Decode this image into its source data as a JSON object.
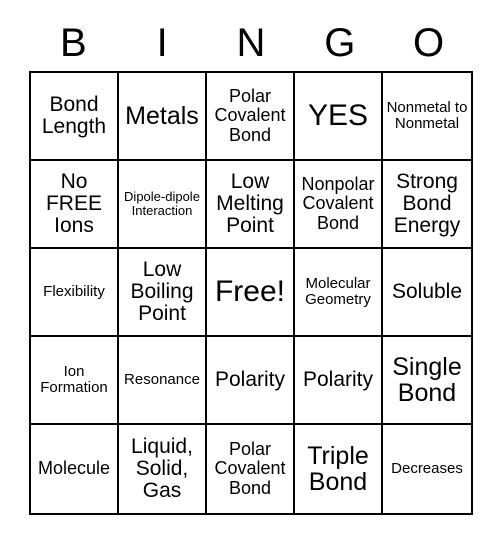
{
  "card": {
    "type": "bingo-card",
    "columns": 5,
    "rows": 5,
    "header": {
      "letters": [
        "B",
        "I",
        "N",
        "G",
        "O"
      ]
    },
    "colors": {
      "border": "#000000",
      "background": "#ffffff",
      "text": "#000000"
    },
    "cells": [
      {
        "text": "Bond Length",
        "size": "lg"
      },
      {
        "text": "Metals",
        "size": "xl"
      },
      {
        "text": "Polar Covalent Bond",
        "size": "md"
      },
      {
        "text": "YES",
        "size": "xxl"
      },
      {
        "text": "Nonmetal to Nonmetal",
        "size": "sm"
      },
      {
        "text": "No FREE Ions",
        "size": "lg"
      },
      {
        "text": "Dipole-dipole Interaction",
        "size": "xs"
      },
      {
        "text": "Low Melting Point",
        "size": "lg"
      },
      {
        "text": "Nonpolar Covalent Bond",
        "size": "md"
      },
      {
        "text": "Strong Bond Energy",
        "size": "lg"
      },
      {
        "text": "Flexibility",
        "size": "sm"
      },
      {
        "text": "Low Boiling Point",
        "size": "lg"
      },
      {
        "text": "Free!",
        "size": "xxl"
      },
      {
        "text": "Molecular Geometry",
        "size": "sm"
      },
      {
        "text": "Soluble",
        "size": "lg"
      },
      {
        "text": "Ion Formation",
        "size": "sm"
      },
      {
        "text": "Resonance",
        "size": "sm"
      },
      {
        "text": "Polarity",
        "size": "lg"
      },
      {
        "text": "Polarity",
        "size": "lg"
      },
      {
        "text": "Single Bond",
        "size": "xl"
      },
      {
        "text": "Molecule",
        "size": "md"
      },
      {
        "text": "Liquid, Solid, Gas",
        "size": "lg"
      },
      {
        "text": "Polar Covalent Bond",
        "size": "md"
      },
      {
        "text": "Triple Bond",
        "size": "xl"
      },
      {
        "text": "Decreases",
        "size": "sm"
      }
    ]
  }
}
